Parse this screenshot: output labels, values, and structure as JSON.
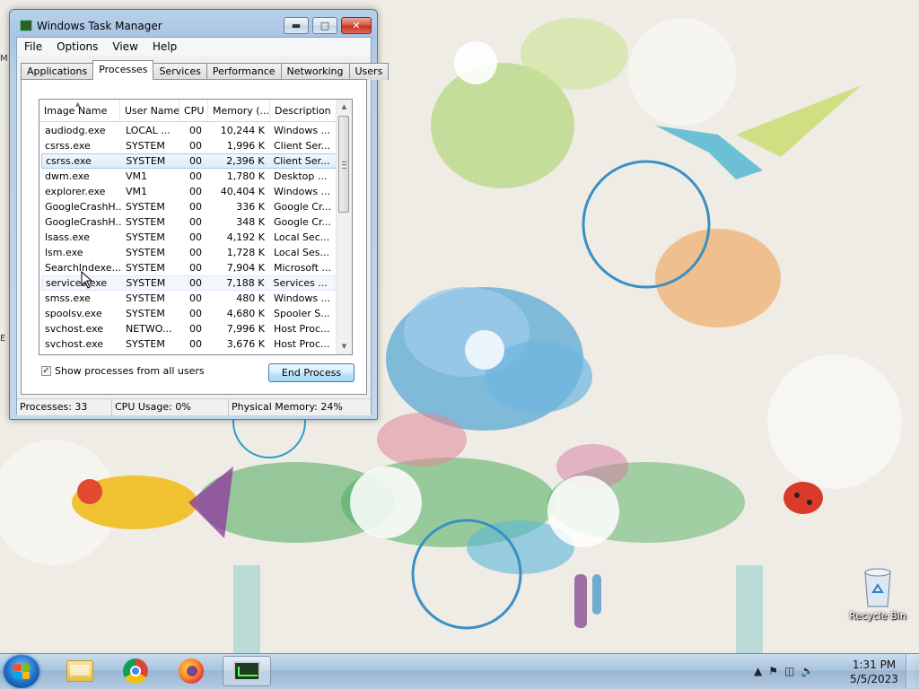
{
  "window": {
    "title": "Windows Task Manager",
    "menu": [
      "File",
      "Options",
      "View",
      "Help"
    ],
    "tabs": [
      "Applications",
      "Processes",
      "Services",
      "Performance",
      "Networking",
      "Users"
    ],
    "active_tab": "Processes",
    "columns": [
      "Image Name",
      "User Name",
      "CPU",
      "Memory (...",
      "Description"
    ],
    "processes": [
      {
        "name": "audiodg.exe",
        "user": "LOCAL ...",
        "cpu": "00",
        "mem": "10,244 K",
        "desc": "Windows ..."
      },
      {
        "name": "csrss.exe",
        "user": "SYSTEM",
        "cpu": "00",
        "mem": "1,996 K",
        "desc": "Client Ser..."
      },
      {
        "name": "csrss.exe",
        "user": "SYSTEM",
        "cpu": "00",
        "mem": "2,396 K",
        "desc": "Client Ser..."
      },
      {
        "name": "dwm.exe",
        "user": "VM1",
        "cpu": "00",
        "mem": "1,780 K",
        "desc": "Desktop ..."
      },
      {
        "name": "explorer.exe",
        "user": "VM1",
        "cpu": "00",
        "mem": "40,404 K",
        "desc": "Windows ..."
      },
      {
        "name": "GoogleCrashH...",
        "user": "SYSTEM",
        "cpu": "00",
        "mem": "336 K",
        "desc": "Google Cr..."
      },
      {
        "name": "GoogleCrashH...",
        "user": "SYSTEM",
        "cpu": "00",
        "mem": "348 K",
        "desc": "Google Cr..."
      },
      {
        "name": "lsass.exe",
        "user": "SYSTEM",
        "cpu": "00",
        "mem": "4,192 K",
        "desc": "Local Sec..."
      },
      {
        "name": "lsm.exe",
        "user": "SYSTEM",
        "cpu": "00",
        "mem": "1,728 K",
        "desc": "Local Ses..."
      },
      {
        "name": "SearchIndexe...",
        "user": "SYSTEM",
        "cpu": "00",
        "mem": "7,904 K",
        "desc": "Microsoft ..."
      },
      {
        "name": "services.exe",
        "user": "SYSTEM",
        "cpu": "00",
        "mem": "7,188 K",
        "desc": "Services ..."
      },
      {
        "name": "smss.exe",
        "user": "SYSTEM",
        "cpu": "00",
        "mem": "480 K",
        "desc": "Windows ..."
      },
      {
        "name": "spoolsv.exe",
        "user": "SYSTEM",
        "cpu": "00",
        "mem": "4,680 K",
        "desc": "Spooler S..."
      },
      {
        "name": "svchost.exe",
        "user": "NETWO...",
        "cpu": "00",
        "mem": "7,996 K",
        "desc": "Host Proc..."
      },
      {
        "name": "svchost.exe",
        "user": "SYSTEM",
        "cpu": "00",
        "mem": "3,676 K",
        "desc": "Host Proc..."
      }
    ],
    "selected_row": 2,
    "hover_row": 10,
    "show_all_label": "Show processes from all users",
    "show_all_checked": true,
    "end_process_label": "End Process",
    "status": {
      "processes": "Processes: 33",
      "cpu": "CPU Usage: 0%",
      "memory": "Physical Memory: 24%"
    }
  },
  "desktop": {
    "recycle_bin_label": "Recycle Bin"
  },
  "taskbar": {
    "apps": [
      "windows-explorer-icon",
      "chrome-icon",
      "firefox-icon",
      "task-manager-icon"
    ],
    "time": "1:31 PM",
    "date": "5/5/2023"
  }
}
